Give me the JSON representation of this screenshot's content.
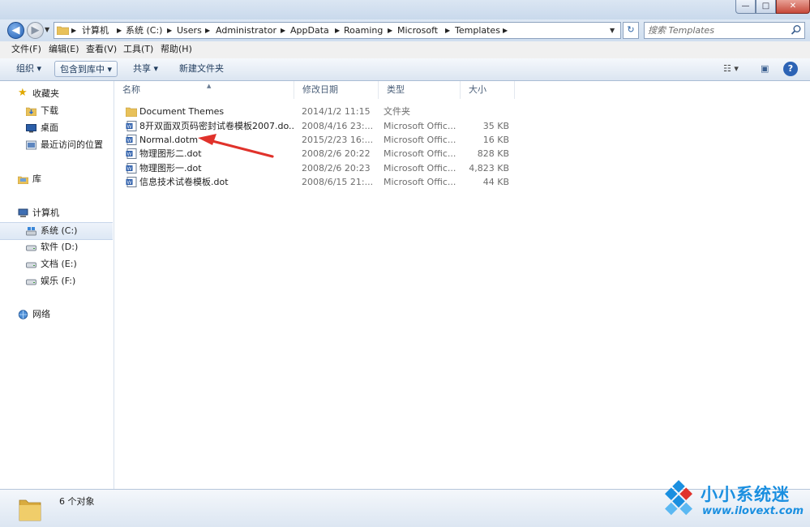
{
  "window": {
    "minimize_glyph": "—",
    "maximize_glyph": "□",
    "close_glyph": "✕"
  },
  "address": {
    "crumbs": [
      "计算机",
      "系统 (C:)",
      "Users",
      "Administrator",
      "AppData",
      "Roaming",
      "Microsoft",
      "Templates"
    ],
    "separator": "▶",
    "dropdown_glyph": "▼",
    "refresh_glyph": "↻",
    "back_glyph": "◀",
    "forward_glyph": "▶",
    "history_glyph": "▼"
  },
  "search": {
    "placeholder": "搜索 Templates"
  },
  "menu": {
    "items": [
      "文件(F)",
      "编辑(E)",
      "查看(V)",
      "工具(T)",
      "帮助(H)"
    ]
  },
  "toolbar": {
    "organize": "组织 ▾",
    "include_in_library": "包含到库中 ▾",
    "share": "共享 ▾",
    "new_folder": "新建文件夹",
    "view_glyph": "☷ ▾",
    "preview_glyph": "▣",
    "help_glyph": "?"
  },
  "nav": {
    "favorites": "收藏夹",
    "downloads": "下载",
    "desktop": "桌面",
    "recent": "最近访问的位置",
    "libraries": "库",
    "computer": "计算机",
    "drive_c": "系统 (C:)",
    "drive_d": "软件 (D:)",
    "drive_e": "文档 (E:)",
    "drive_f": "娱乐 (F:)",
    "network": "网络"
  },
  "columns": {
    "name": "名称",
    "date": "修改日期",
    "type": "类型",
    "size": "大小"
  },
  "files": [
    {
      "name": "Document Themes",
      "date": "2014/1/2 11:15",
      "type": "文件夹",
      "size": "",
      "icon": "folder-icon"
    },
    {
      "name": "8开双面双页码密封试卷模板2007.do...",
      "date": "2008/4/16 23:...",
      "type": "Microsoft Offic...",
      "size": "35 KB",
      "icon": "word-template-icon"
    },
    {
      "name": "Normal.dotm",
      "date": "2015/2/23 16:...",
      "type": "Microsoft Offic...",
      "size": "16 KB",
      "icon": "word-template-icon"
    },
    {
      "name": "物理图形二.dot",
      "date": "2008/2/6 20:22",
      "type": "Microsoft Offic...",
      "size": "828 KB",
      "icon": "word-template-icon"
    },
    {
      "name": "物理图形一.dot",
      "date": "2008/2/6 20:23",
      "type": "Microsoft Offic...",
      "size": "4,823 KB",
      "icon": "word-template-icon"
    },
    {
      "name": "信息技术试卷模板.dot",
      "date": "2008/6/15 21:...",
      "type": "Microsoft Offic...",
      "size": "44 KB",
      "icon": "word-template-icon"
    }
  ],
  "status": {
    "count": "6 个对象"
  },
  "watermark": {
    "title": "小小系统迷",
    "url": "www.ilovext.com"
  },
  "colors": {
    "accent": "#1a8fe0",
    "arrow": "#e0322b",
    "folder": "#e8c15a"
  }
}
